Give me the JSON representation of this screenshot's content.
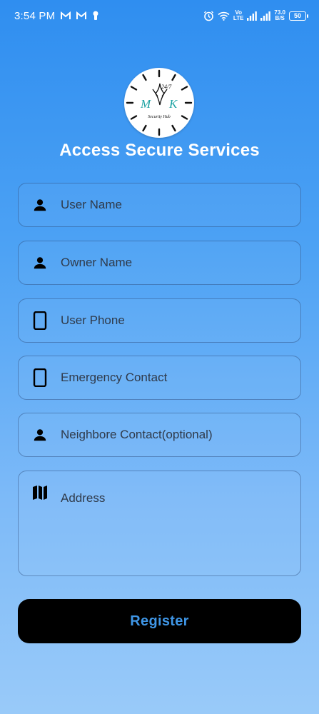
{
  "status_bar": {
    "time": "3:54 PM",
    "volte_label_top": "Vo",
    "volte_label_bottom": "LTE",
    "net_speed_value": "73.0",
    "net_speed_unit": "B/S",
    "battery": "50",
    "icons": [
      "gmail-icon",
      "gmail-icon",
      "keyhole-icon",
      "alarm-icon",
      "wifi-icon",
      "signal-icon",
      "signal-icon"
    ]
  },
  "logo": {
    "top_text": "24/7",
    "letters_left": "M",
    "letters_right": "K",
    "bottom_text": "Security Hub"
  },
  "title": "Access Secure Services",
  "form": {
    "user_name": {
      "placeholder": "User Name",
      "icon": "person-icon"
    },
    "owner_name": {
      "placeholder": "Owner Name",
      "icon": "person-icon"
    },
    "user_phone": {
      "placeholder": "User Phone",
      "icon": "phone-icon"
    },
    "emergency_contact": {
      "placeholder": "Emergency Contact",
      "icon": "phone-icon"
    },
    "neighbor_contact": {
      "placeholder": "Neighbore Contact(optional)",
      "icon": "person-icon"
    },
    "address": {
      "placeholder": "Address",
      "icon": "map-icon"
    }
  },
  "register_label": "Register",
  "colors": {
    "gradient_top": "#2f8ef0",
    "gradient_bottom": "#99caf9",
    "button_bg": "#000000",
    "button_text": "#3f96e6",
    "logo_accent": "#1fa3a3"
  }
}
